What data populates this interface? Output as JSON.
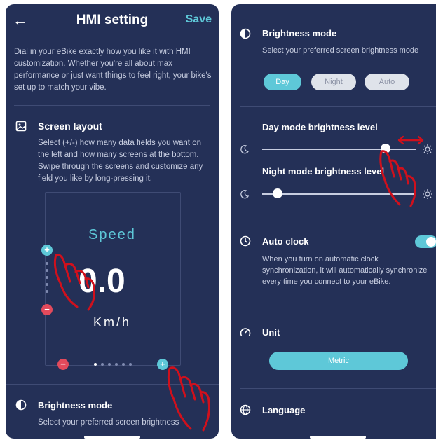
{
  "left_screen": {
    "header": {
      "back_icon": "arrow-left-icon",
      "title": "HMI setting",
      "save_label": "Save"
    },
    "intro": "Dial in your eBike exactly how you like it with HMI customization. Whether you're all about max performance or just want things to feel right, your bike's set up to match your vibe.",
    "screen_layout": {
      "title": "Screen layout",
      "icon": "image-icon",
      "description": "Select (+/-) how many data fields you want on the left and how many screens at the bottom. Swipe through the screens and customize any field you like by long-pressing it.",
      "preview": {
        "speed_label": "Speed",
        "speed_value": "0.0",
        "unit": "Km/h",
        "page_dots": 6
      }
    },
    "brightness_peek": {
      "title": "Brightness mode",
      "icon": "half-circle-icon",
      "description": "Select your preferred screen brightness"
    }
  },
  "right_screen": {
    "brightness": {
      "title": "Brightness mode",
      "icon": "half-circle-icon",
      "description": "Select your preferred screen brightness mode",
      "options": [
        "Day",
        "Night",
        "Auto"
      ],
      "selected": "Day"
    },
    "day_level": {
      "title": "Day mode brightness level",
      "value": 0.8
    },
    "night_level": {
      "title": "Night mode brightness level",
      "value": 0.1
    },
    "auto_clock": {
      "title": "Auto clock",
      "icon": "clock-icon",
      "description": "When you turn on automatic clock synchronization, it will automatically synchronize every time you connect to your eBike.",
      "enabled": true
    },
    "unit": {
      "title": "Unit",
      "icon": "gauge-icon",
      "value": "Metric"
    },
    "language": {
      "title": "Language",
      "icon": "globe-icon"
    }
  },
  "colors": {
    "background": "#243057",
    "accent": "#5ec8d8",
    "danger": "#e34a5c",
    "hint": "#d0101c"
  }
}
